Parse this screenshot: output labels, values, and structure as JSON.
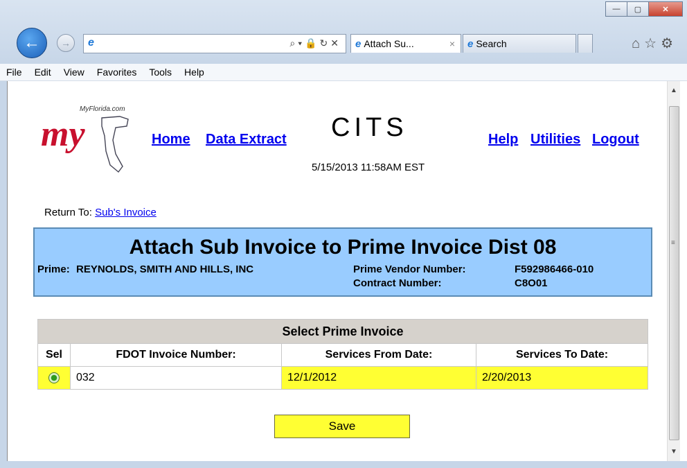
{
  "browser": {
    "tabs": [
      {
        "label": "Attach Su...",
        "close": "×"
      },
      {
        "label": "Search"
      }
    ],
    "address_icon": "ie-icon",
    "menu": [
      "File",
      "Edit",
      "View",
      "Favorites",
      "Tools",
      "Help"
    ]
  },
  "header": {
    "logo_site": "MyFlorida.com",
    "logo_text": "my",
    "app_title": "CITS",
    "datetime": "5/15/2013   11:58AM EST",
    "nav_left": [
      "Home",
      "Data Extract"
    ],
    "nav_right": [
      "Help",
      "Utilities",
      "Logout"
    ]
  },
  "return_to": {
    "label": "Return To:",
    "link": "Sub's Invoice"
  },
  "banner": {
    "title": "Attach Sub Invoice to Prime Invoice Dist 08",
    "prime_label": "Prime:",
    "prime_value": "REYNOLDS, SMITH AND HILLS, INC",
    "vendor_label": "Prime Vendor Number:",
    "vendor_value": "F592986466-010",
    "contract_label": "Contract Number:",
    "contract_value": "C8O01"
  },
  "table": {
    "caption": "Select Prime Invoice",
    "columns": [
      "Sel",
      "FDOT Invoice Number:",
      "Services From Date:",
      "Services To Date:"
    ],
    "rows": [
      {
        "selected": true,
        "invoice": "032",
        "from": "12/1/2012",
        "to": "2/20/2013"
      }
    ]
  },
  "actions": {
    "save": "Save"
  },
  "colors": {
    "banner": "#99ccff",
    "highlight": "#ffff33",
    "link": "#0000ee",
    "logo": "#c8102e"
  }
}
